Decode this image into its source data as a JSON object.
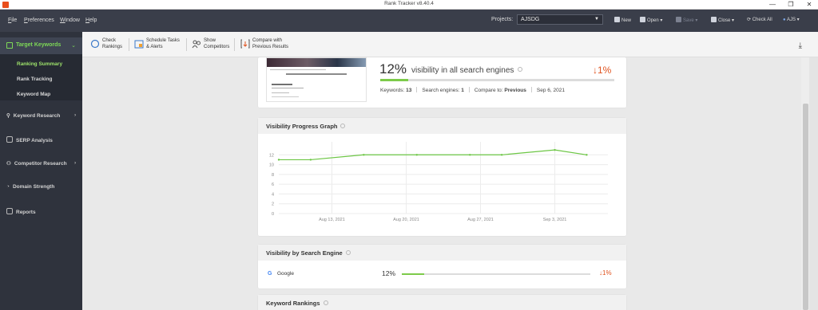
{
  "window": {
    "title": "Rank Tracker v8.40.4",
    "controls": {
      "minimize": "—",
      "restore": "❐",
      "close": "✕"
    }
  },
  "menu": {
    "items": [
      {
        "label": "File",
        "ul": "F",
        "rest": "ile"
      },
      {
        "label": "Preferences",
        "ul": "P",
        "rest": "references"
      },
      {
        "label": "Window",
        "ul": "W",
        "rest": "indow"
      },
      {
        "label": "Help",
        "ul": "H",
        "rest": "elp"
      }
    ],
    "projects_label": "Projects:",
    "project_value": "AJSDG",
    "buttons": {
      "new": "New",
      "open": "Open",
      "save": "Save",
      "close": "Close",
      "check_all": "Check All",
      "user": "AJS"
    }
  },
  "sidebar": {
    "header": "Target Keywords",
    "sub_items": [
      "Ranking Summary",
      "Rank Tracking",
      "Keyword Map"
    ],
    "items": [
      {
        "label": "Keyword Research",
        "icon": "search-icon",
        "has_arrow": true
      },
      {
        "label": "SERP Analysis",
        "icon": "chart-icon",
        "has_arrow": false
      },
      {
        "label": "Competitor Research",
        "icon": "person-icon",
        "has_arrow": true
      },
      {
        "label": "Domain Strength",
        "icon": "gauge-icon",
        "has_arrow": false
      },
      {
        "label": "Reports",
        "icon": "report-icon",
        "has_arrow": false
      }
    ]
  },
  "toolbar": {
    "check_rankings": [
      "Check",
      "Rankings"
    ],
    "schedule": [
      "Schedule Tasks",
      "& Alerts"
    ],
    "show_competitors": [
      "Show",
      "Competitors"
    ],
    "compare": [
      "Compare with",
      "Previous Results"
    ]
  },
  "summary": {
    "percent": "12%",
    "description": "visibility in all search engines",
    "change": "↓1%",
    "bar_fraction": 0.12,
    "keywords_label": "Keywords:",
    "keywords_value": "13",
    "engines_label": "Search engines:",
    "engines_value": "1",
    "compare_label": "Compare to:",
    "compare_value": "Previous",
    "date": "Sep 6, 2021"
  },
  "graph_card": {
    "title": "Visibility Progress Graph"
  },
  "chart_data": {
    "type": "line",
    "x": [
      "Aug 8, 2021",
      "Aug 11, 2021",
      "Aug 16, 2021",
      "Aug 21, 2021",
      "Aug 26, 2021",
      "Aug 29, 2021",
      "Sep 3, 2021",
      "Sep 6, 2021"
    ],
    "x_day_offsets": [
      0,
      3,
      8,
      13,
      18,
      21,
      26,
      29
    ],
    "values": [
      11,
      11,
      12,
      12,
      12,
      12,
      13,
      12
    ],
    "x_ticks": [
      "Aug 13, 2021",
      "Aug 20, 2021",
      "Aug 27, 2021",
      "Sep 3, 2021"
    ],
    "x_tick_offsets": [
      5,
      12,
      19,
      26
    ],
    "y_ticks": [
      "0",
      "2",
      "4",
      "6",
      "8",
      "10",
      "12"
    ],
    "ylim": [
      0,
      14
    ],
    "xlim_days": [
      0,
      31
    ],
    "grid": true,
    "color": "#6cc644"
  },
  "engine_card": {
    "title": "Visibility by Search Engine",
    "logo": "G",
    "engine": "Google",
    "percent": "12%",
    "bar_fraction": 0.12,
    "change": "↓1%"
  },
  "rankings_card": {
    "title": "Keyword Rankings"
  }
}
